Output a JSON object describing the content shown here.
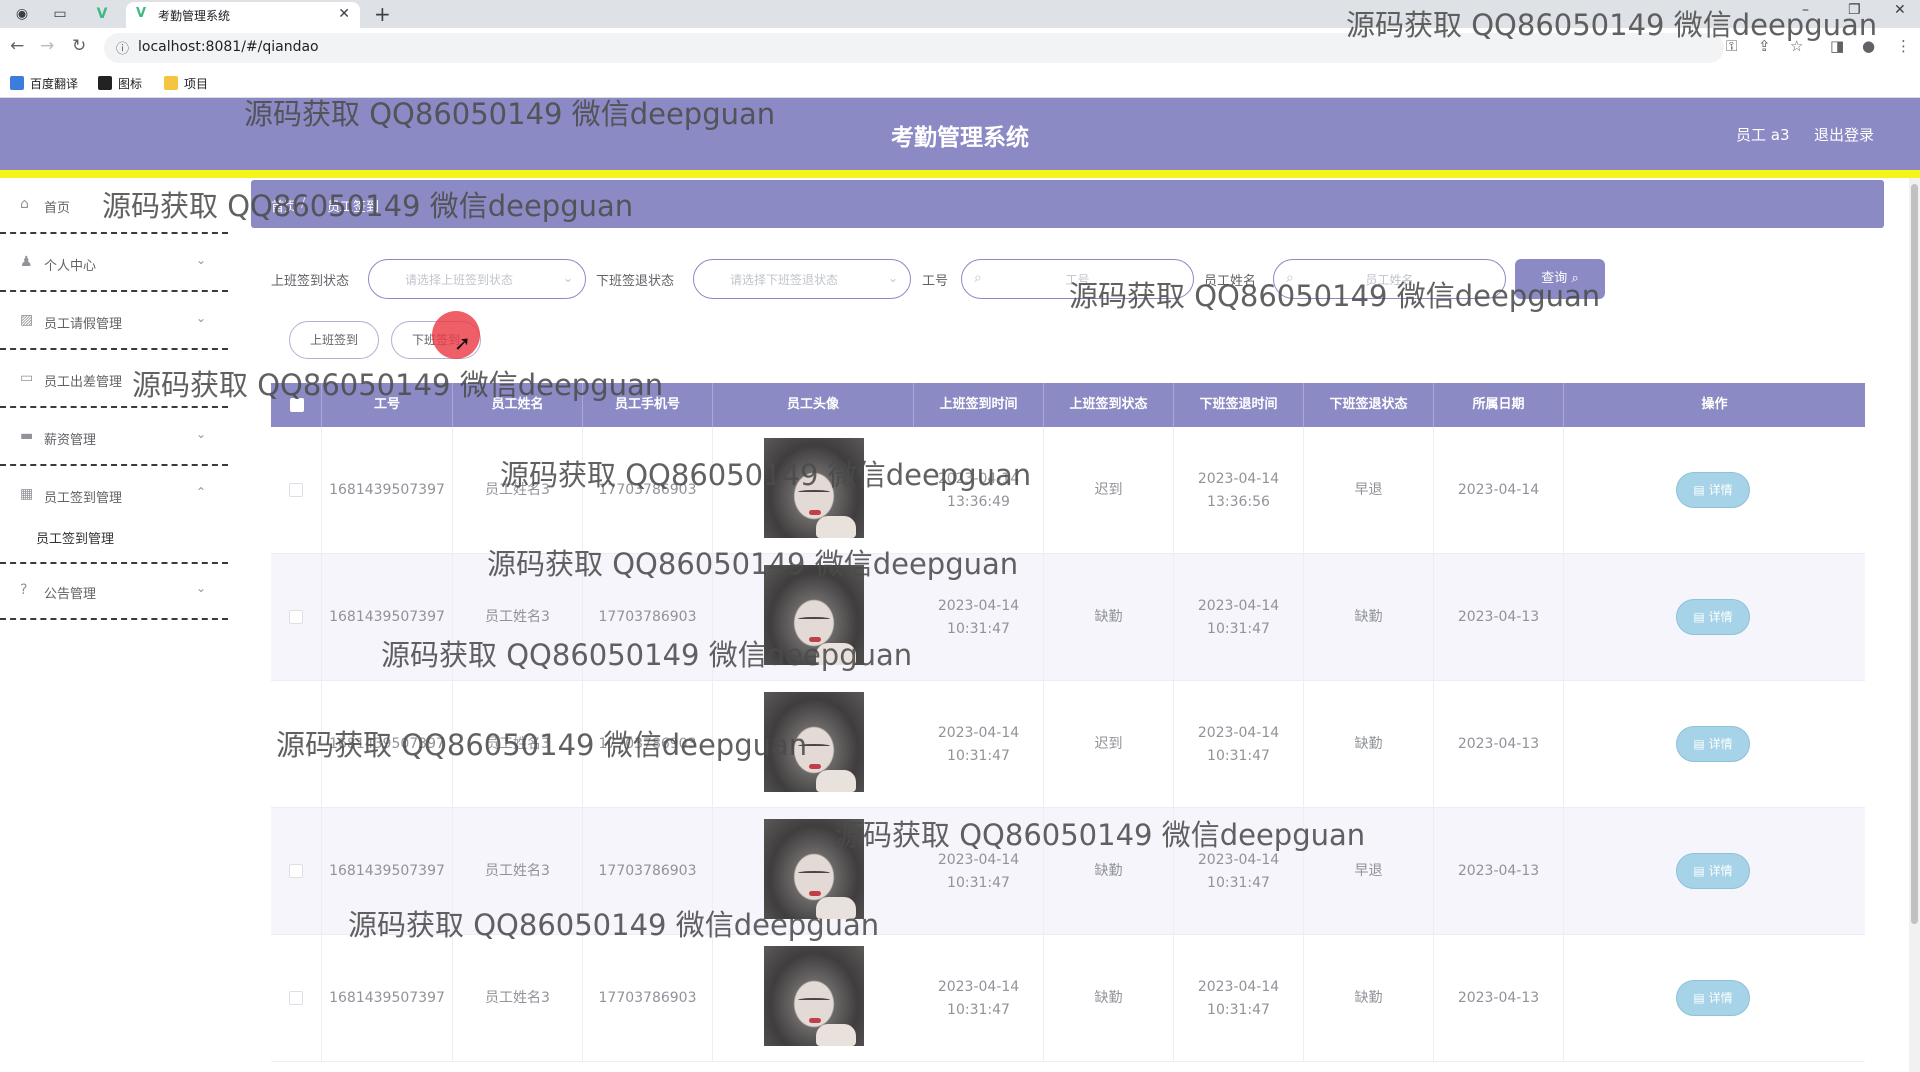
{
  "browser": {
    "tab_title": "考勤管理系统",
    "url": "localhost:8081/#/qiandao",
    "bookmarks": [
      "百度翻译",
      "图标",
      "项目"
    ]
  },
  "header": {
    "title": "考勤管理系统",
    "user": "员工 a3",
    "logout": "退出登录",
    "bar_color": "#8b8ac4",
    "accent_color": "#f5f51a"
  },
  "sidebar": {
    "items": [
      {
        "label": "首页",
        "icon": "home-icon"
      },
      {
        "label": "个人中心",
        "icon": "user-icon"
      },
      {
        "label": "员工请假管理",
        "icon": "chart-icon"
      },
      {
        "label": "员工出差管理",
        "icon": "chat-icon"
      },
      {
        "label": "薪资管理",
        "icon": "monitor-icon"
      },
      {
        "label": "员工签到管理",
        "icon": "grid-icon"
      },
      {
        "label": "公告管理",
        "icon": "help-icon"
      }
    ],
    "sub_item": "员工签到管理"
  },
  "breadcrumb": {
    "home": "首页",
    "current": "员工签到"
  },
  "filters": {
    "checkin_status_label": "上班签到状态",
    "checkin_status_placeholder": "请选择上班签到状态",
    "checkout_status_label": "下班签退状态",
    "checkout_status_placeholder": "请选择下班签退状态",
    "emp_no_label": "工号",
    "emp_no_placeholder": "工号",
    "emp_name_label": "员工姓名",
    "emp_name_placeholder": "员工姓名",
    "query": "查询"
  },
  "actions": {
    "checkin": "上班签到",
    "checkout": "下班签到"
  },
  "table": {
    "columns": [
      "工号",
      "员工姓名",
      "员工手机号",
      "员工头像",
      "上班签到时间",
      "上班签到状态",
      "下班签退时间",
      "下班签退状态",
      "所属日期",
      "操作"
    ],
    "detail_label": "详情",
    "rows": [
      {
        "no": "1681439507397",
        "name": "员工姓名3",
        "phone": "17703786903",
        "in_time": "2023-04-14 13:36:49",
        "in_status": "迟到",
        "out_time": "2023-04-14 13:36:56",
        "out_status": "早退",
        "date": "2023-04-14"
      },
      {
        "no": "1681439507397",
        "name": "员工姓名3",
        "phone": "17703786903",
        "in_time": "2023-04-14 10:31:47",
        "in_status": "缺勤",
        "out_time": "2023-04-14 10:31:47",
        "out_status": "缺勤",
        "date": "2023-04-13"
      },
      {
        "no": "1681439507397",
        "name": "员工姓名3",
        "phone": "17703786903",
        "in_time": "2023-04-14 10:31:47",
        "in_status": "迟到",
        "out_time": "2023-04-14 10:31:47",
        "out_status": "缺勤",
        "date": "2023-04-13"
      },
      {
        "no": "1681439507397",
        "name": "员工姓名3",
        "phone": "17703786903",
        "in_time": "2023-04-14 10:31:47",
        "in_status": "缺勤",
        "out_time": "2023-04-14 10:31:47",
        "out_status": "早退",
        "date": "2023-04-13"
      },
      {
        "no": "1681439507397",
        "name": "员工姓名3",
        "phone": "17703786903",
        "in_time": "2023-04-14 10:31:47",
        "in_status": "缺勤",
        "out_time": "2023-04-14 10:31:47",
        "out_status": "缺勤",
        "date": "2023-04-13"
      }
    ]
  },
  "watermark": "源码获取 QQ86050149 微信deepguan"
}
